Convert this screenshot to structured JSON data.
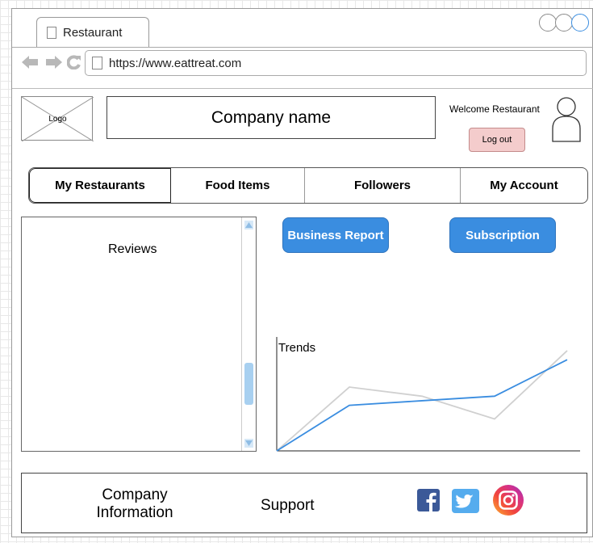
{
  "browser": {
    "tab_title": "Restaurant",
    "url": "https://www.eattreat.com"
  },
  "header": {
    "logo_label": "Logo",
    "company_name": "Company name",
    "welcome_text": "Welcome Restaurant",
    "logout_label": "Log out"
  },
  "nav": {
    "tabs": [
      {
        "label": "My Restaurants"
      },
      {
        "label": "Food Items"
      },
      {
        "label": "Followers"
      },
      {
        "label": "My Account"
      }
    ]
  },
  "reviews": {
    "label": "Reviews",
    "scroll_position": 0.66
  },
  "actions": {
    "business_report": "Business Report",
    "subscription": "Subscription"
  },
  "chart_data": {
    "type": "line",
    "title": "Trends",
    "x": [
      0,
      1,
      2,
      3,
      4
    ],
    "series": [
      {
        "color": "#3a8de0",
        "values": [
          0,
          1,
          1.1,
          1.2,
          2.0
        ]
      },
      {
        "color": "#d0d0d0",
        "values": [
          0,
          1.4,
          1.2,
          0.7,
          2.2
        ]
      }
    ],
    "ylim": [
      0,
      2.5
    ],
    "grid": false
  },
  "footer": {
    "company_info": "Company Information",
    "support": "Support",
    "social": [
      "facebook-icon",
      "twitter-icon",
      "instagram-icon"
    ]
  },
  "colors": {
    "accent": "#3a8de0",
    "logout_bg": "#f4cccc"
  }
}
